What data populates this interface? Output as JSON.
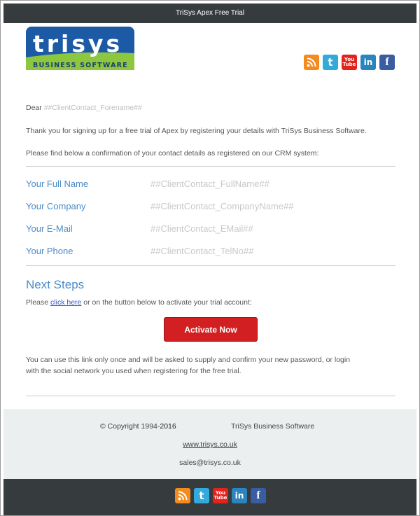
{
  "header": {
    "title": "TriSys Apex Free Trial"
  },
  "logo": {
    "wordmark": "trisys",
    "tagline": "BUSINESS SOFTWARE",
    "colors": {
      "blue": "#1d5aa6",
      "green": "#8dc63f"
    }
  },
  "social_icons": [
    {
      "name": "rss-icon",
      "glyph": "rss"
    },
    {
      "name": "twitter-icon",
      "glyph": "t"
    },
    {
      "name": "youtube-icon",
      "glyph": "You Tube"
    },
    {
      "name": "linkedin-icon",
      "glyph": "in"
    },
    {
      "name": "facebook-icon",
      "glyph": "f"
    }
  ],
  "body": {
    "greeting_prefix": "Dear ",
    "greeting_placeholder": "##ClientContact_Forename##",
    "intro": "Thank you for signing up for a free trial of Apex by registering your details with TriSys Business Software.",
    "confirm": "Please find below a confirmation of your contact details as registered on our CRM system:",
    "details": [
      {
        "label": "Your Full Name",
        "value": "##ClientContact_FullName##"
      },
      {
        "label": "Your Company",
        "value": "##ClientContact_CompanyName##"
      },
      {
        "label": "Your E-Mail",
        "value": "##ClientContact_EMail##"
      },
      {
        "label": "Your Phone",
        "value": "##ClientContact_TelNo##"
      }
    ],
    "next_steps_title": "Next Steps",
    "next_steps_prefix": "Please ",
    "next_steps_link": "click here",
    "next_steps_suffix": " or on the button below to activate your trial account:",
    "activate_button": "Activate Now",
    "note_line1": "You can use this link only once and will be asked to supply and confirm your new password, or login",
    "note_line2": "with the social network you used when registering for the free trial."
  },
  "footer": {
    "copyright_prefix": "© Copyright 1994-",
    "copyright_year": "2016",
    "company": "TriSys Business Software",
    "website": "www.trisys.co.uk",
    "email": "sales@trisys.co.uk"
  }
}
